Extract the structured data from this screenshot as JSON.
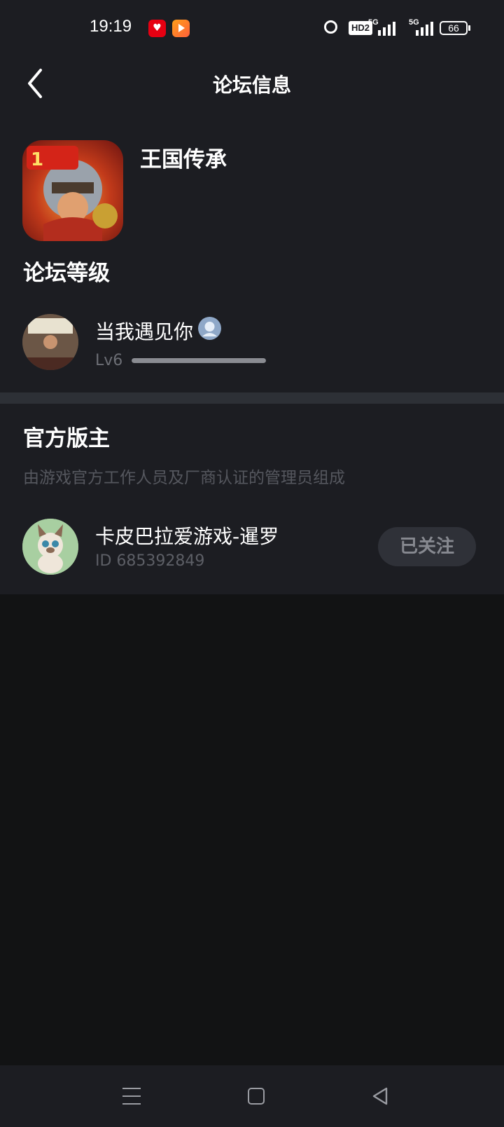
{
  "status_bar": {
    "time": "19:19",
    "battery": "66",
    "network_1": "5G",
    "network_2": "5G",
    "hd_badge": "HD2"
  },
  "header": {
    "title": "论坛信息"
  },
  "forum": {
    "game_name": "王国传承",
    "level_section_title": "论坛等级",
    "user": {
      "name": "当我遇见你",
      "level": "Lv6",
      "level_progress": 1.0
    }
  },
  "moderators": {
    "section_title": "官方版主",
    "subtitle": "由游戏官方工作人员及厂商认证的管理员组成",
    "items": [
      {
        "name": "卡皮巴拉爱游戏-暹罗",
        "id_label": "ID 685392849",
        "follow_label": "已关注"
      }
    ]
  },
  "colors": {
    "card_bg": "#1c1d22",
    "page_bg": "#121314",
    "divider": "#2d3036",
    "follow_bg": "#2f3138"
  }
}
